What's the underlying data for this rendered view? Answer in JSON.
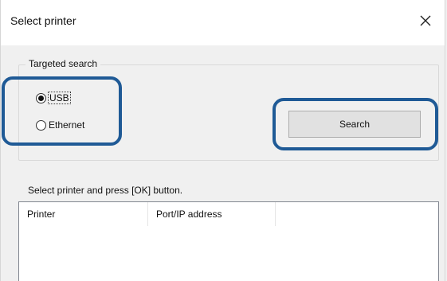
{
  "dialog": {
    "title": "Select printer",
    "close_label": "×"
  },
  "search_group": {
    "title": "Targeted search",
    "options": [
      {
        "label": "USB",
        "selected": true
      },
      {
        "label": "Ethernet",
        "selected": false
      }
    ],
    "search_button_label": "Search"
  },
  "printer_list": {
    "instruction": "Select printer and press [OK] button.",
    "columns": [
      "Printer",
      "Port/IP address"
    ],
    "rows": []
  },
  "colors": {
    "highlight": "#1f5a96",
    "window_bg": "#f0f0f0",
    "titlebar_bg": "#ffffff",
    "button_bg": "#e1e1e1"
  }
}
